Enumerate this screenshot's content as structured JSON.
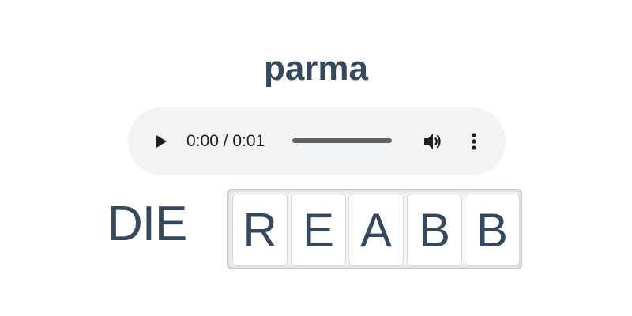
{
  "word": "parma",
  "audio_player": {
    "time_display": "0:00 / 0:01",
    "progress": 0.0,
    "icons": {
      "play": "play-icon",
      "volume": "volume-icon",
      "more": "more-vert-icon"
    }
  },
  "prefix": "DIE",
  "tiles": [
    "R",
    "E",
    "A",
    "B",
    "B"
  ],
  "colors": {
    "text": "#34495e",
    "audio_bg": "#f1f3f4",
    "tile_border": "#d3d7db",
    "tray_bg": "#f4f5f6"
  }
}
